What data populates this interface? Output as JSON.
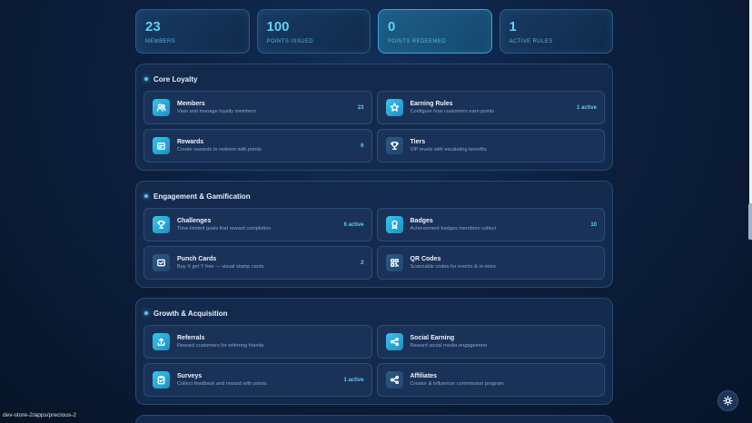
{
  "stats": [
    {
      "value": "23",
      "label": "MEMBERS"
    },
    {
      "value": "100",
      "label": "POINTS ISSUED"
    },
    {
      "value": "0",
      "label": "POINTS REDEEMED"
    },
    {
      "value": "1",
      "label": "ACTIVE RULES"
    }
  ],
  "sections": [
    {
      "title": "Core Loyalty",
      "cards": [
        {
          "title": "Members",
          "desc": "View and manage loyalty members",
          "badge": "23",
          "icon": "users-icon"
        },
        {
          "title": "Earning Rules",
          "desc": "Configure how customers earn points",
          "badge": "1 active",
          "icon": "star-icon"
        },
        {
          "title": "Rewards",
          "desc": "Create rewards to redeem with points",
          "badge": "6",
          "icon": "gift-icon"
        },
        {
          "title": "Tiers",
          "desc": "VIP levels with escalating benefits",
          "badge": "",
          "icon": "trophy-icon"
        }
      ]
    },
    {
      "title": "Engagement & Gamification",
      "cards": [
        {
          "title": "Challenges",
          "desc": "Time-limited goals that reward completion",
          "badge": "6 active",
          "icon": "trophy-icon"
        },
        {
          "title": "Badges",
          "desc": "Achievement badges members collect",
          "badge": "10",
          "icon": "medal-icon"
        },
        {
          "title": "Punch Cards",
          "desc": "Buy X get Y free — visual stamp cards",
          "badge": "2",
          "icon": "card-icon"
        },
        {
          "title": "QR Codes",
          "desc": "Scannable codes for events & in-store",
          "badge": "",
          "icon": "qr-icon"
        }
      ]
    },
    {
      "title": "Growth & Acquisition",
      "cards": [
        {
          "title": "Referrals",
          "desc": "Reward customers for referring friends",
          "badge": "",
          "icon": "share-icon"
        },
        {
          "title": "Social Earning",
          "desc": "Reward social media engagement",
          "badge": "",
          "icon": "network-icon"
        },
        {
          "title": "Surveys",
          "desc": "Collect feedback and reward with points",
          "badge": "1 active",
          "icon": "clipboard-icon"
        },
        {
          "title": "Affiliates",
          "desc": "Creator & influencer commission program",
          "badge": "",
          "icon": "link-icon"
        }
      ]
    }
  ],
  "status_url": "dev-store-2/apps/precious-2"
}
